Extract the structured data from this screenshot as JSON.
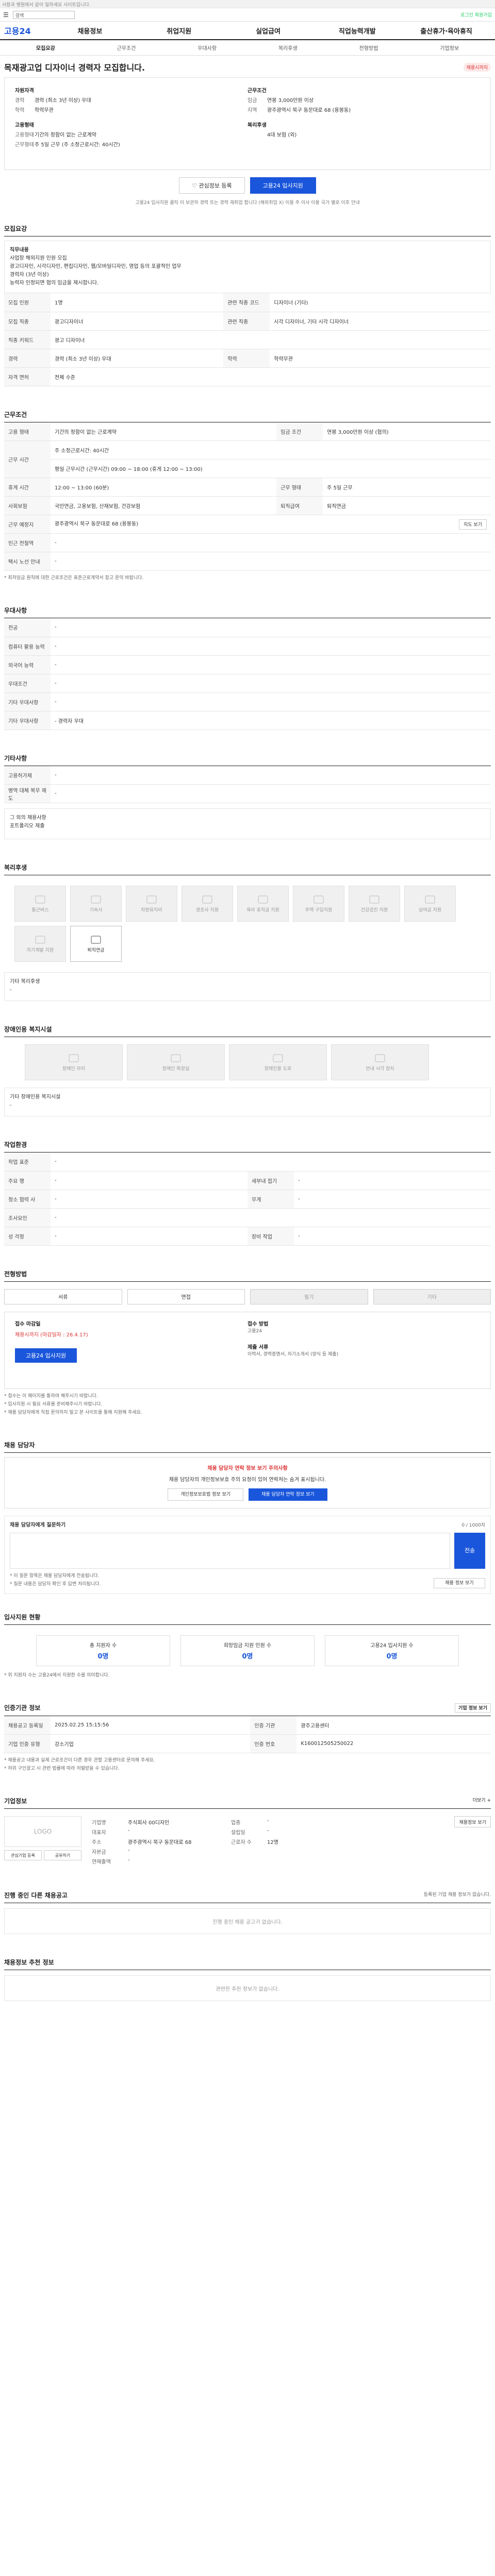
{
  "top": {
    "notice": "사람과 병원에서 같이 일하세요 사이트입니다.",
    "search_placeholder": "검색",
    "right": "로그인 회원가입"
  },
  "nav": {
    "logo": "고용24",
    "items": [
      "채용정보",
      "취업지원",
      "실업급여",
      "직업능력개발",
      "출산휴가·육아휴직"
    ]
  },
  "tabs": [
    "모집요강",
    "근무조건",
    "우대사항",
    "복리후생",
    "전형방법",
    "기업정보"
  ],
  "job": {
    "title": "목재광고업 디자이너 경력자 모집합니다.",
    "badge": "채용시까지"
  },
  "summary": {
    "left_title": "자원자격",
    "left": [
      [
        "경력",
        "경력 (최소 3년 이상) 우대"
      ],
      [
        "학력",
        "학력무관"
      ]
    ],
    "emp_title": "고용형태",
    "emp": [
      [
        "고용형태",
        "기간의 정함이 없는 근로계약"
      ],
      [
        "근무형태",
        "주 5일 근무 (주 소정근로시간: 40시간)"
      ]
    ],
    "right_title": "근무조건",
    "right": [
      [
        "임금",
        "연봉 3,000만원 이상"
      ],
      [
        "지역",
        "광주광역시 북구 동문대로 68 (용봉동)"
      ]
    ],
    "welfare_title": "복리후생",
    "welfare": [
      [
        "",
        "4대 보험 (외)"
      ]
    ]
  },
  "buttons": {
    "save": "관심정보 등록",
    "apply": "고용24 입사지원"
  },
  "note": "고용24 입사지원 클릭 이 보관하 경력 또는 경력 재취업 합니다 (해외취업 X) 이용 주 이사 이용 국가 별로 이후 안내",
  "recruit": {
    "head": "모집요강",
    "desc": [
      "직무내용",
      "사업장 해외지원 인원 모집",
      "광고디자인, 시각디자인, 편집디자인, 웹/모바일디자인, 영업 등의 포괄적인 업무",
      "경력자 (3년 이상)",
      "능력자 인정되면 협의 임금을 제시합니다."
    ],
    "rows": [
      [
        "모집 인원",
        "1명",
        "관련 직종 코드",
        "디자이너 (기타)"
      ],
      [
        "모집 직종",
        "광고디자이너",
        "관련 직종",
        "시각 디자이너, 기타 시각 디자이너"
      ],
      [
        "직종 키워드",
        "광고 디자이너",
        null,
        null
      ],
      [
        "경력",
        "경력 (최소 3년 이상) 우대",
        "학력",
        "학력무관"
      ],
      [
        "자격 면허",
        "전체 수준",
        null,
        null
      ]
    ]
  },
  "work": {
    "head": "근무조건",
    "rows": [
      [
        "고용 형태",
        "기간의 정함이 없는 근로계약",
        "임금 조건",
        "연봉 3,000만원 이상 (협의)"
      ],
      [
        "근무 시간",
        "주 소정근로시간: 40시간",
        "",
        ""
      ],
      [
        "",
        "평일 근무시간 (근무시간) 09:00 ~ 18:00 (휴게 12:00 ~ 13:00)",
        "",
        ""
      ],
      [
        "휴게 시간",
        "12:00 ~ 13:00 (60분)",
        "근무 형태",
        "주 5일 근무"
      ],
      [
        "사회보험",
        "국민연금, 고용보험, 산재보험, 건강보험",
        "퇴직급여",
        "퇴직연금"
      ],
      [
        "근무 예정지",
        "광주광역시 북구 동문대로 68 (용봉동)",
        "",
        ""
      ],
      [
        "인근 전철역",
        "-",
        "",
        ""
      ],
      [
        "택시 노선 안내",
        "-",
        "",
        ""
      ]
    ],
    "map_btn": "지도 보기",
    "note": "* 최저임금 원칙에 대한 근로조건은 표준근로계약서 참고 문의 바랍니다."
  },
  "pref": {
    "head": "우대사항",
    "rows": [
      [
        "전공",
        "-"
      ],
      [
        "컴퓨터 활용 능력",
        "-"
      ],
      [
        "외국어 능력",
        "-"
      ],
      [
        "우대조건",
        "-"
      ],
      [
        "기타 우대사항",
        "-"
      ],
      [
        "기타 우대사항",
        "- 경력자 우대"
      ]
    ]
  },
  "etc": {
    "head": "기타사항",
    "rows": [
      [
        "고용허가제",
        "-"
      ],
      [
        "병역 대체 복무 제도",
        "-"
      ]
    ],
    "box_title": "그 외의 채용사항",
    "box_text": "포트폴리오 제출"
  },
  "welfare": {
    "head": "복리후생",
    "items": [
      [
        "통근버스",
        false
      ],
      [
        "기숙사",
        false
      ],
      [
        "차량유지비",
        false
      ],
      [
        "경조사 지원",
        false
      ],
      [
        "육아 휴직금 지원",
        false
      ],
      [
        "주택 구입지원",
        false
      ],
      [
        "건강검진 지원",
        false
      ],
      [
        "상여금 지원",
        false
      ],
      [
        "자기계발 지원",
        false
      ],
      [
        "퇴직연금",
        true
      ]
    ],
    "other_title": "기타 복리후생",
    "other": "-"
  },
  "disab": {
    "head": "장애인용 복지시설",
    "items": [
      "장애인 자리",
      "장애인 화장실",
      "장애인용 도로",
      "안내 시각 장치"
    ],
    "other_title": "기타 장애인용 복지시설",
    "other": "-"
  },
  "work_env": {
    "head": "작업환경",
    "rows": [
      [
        "작업 표준",
        "-",
        "",
        ""
      ],
      [
        "주요 행",
        "-",
        "세부내 접기",
        "-"
      ],
      [
        "청소 협력 사",
        "-",
        "무게",
        "-"
      ],
      [
        "조사요인",
        "-",
        "",
        ""
      ],
      [
        "성 걱정",
        "-",
        "장비 작업",
        "-"
      ]
    ]
  },
  "select": {
    "head": "전형방법",
    "pills": [
      [
        "서류",
        false
      ],
      [
        "면접",
        false
      ],
      [
        "필기",
        true
      ],
      [
        "기타",
        true
      ]
    ]
  },
  "apply": {
    "left_title": "접수 마감일",
    "deadline": "채용시까지 (마감일자 : 26.4.17)",
    "btn": "고용24 입사지원",
    "right_title": "접수 방법",
    "method": "고용24",
    "doc_title": "제출 서류",
    "docs": "이력서, 경력증명서, 자기소개서 (양식 등 제출)"
  },
  "apply_notes": [
    "* 접수는 이 페이지를 통하여 해주시기 바랍니다.",
    "* 입사지원 시 필요 서류를 준비해주시기 바랍니다.",
    "* 채용 담당자에게 직접 문의하지 말고 본 사이트를 통해 지원해 주세요."
  ],
  "contact": {
    "head": "채용 담당자",
    "title": "채용 담당자 연락 정보 보기 주의사항",
    "text": "채용 담당자의 개인정보보호 주의 요청이 있어 연락처는 숨겨 표시됩니다.",
    "btn1": "개인정보보호법 정보 보기",
    "btn2": "채용 담당자 연락 정보 보기"
  },
  "inquiry": {
    "title": "채용 담당자에게 질문하기",
    "count": "0 / 1000자",
    "btn": "전송",
    "notes": [
      "* 이 질문 항목은 채용 담당자에게 전송됩니다.",
      "* 질문 내용은 담당자 확인 후 답변 처리됩니다."
    ],
    "more": "채용 정보 보기"
  },
  "status": {
    "head": "입사지원 현황",
    "cards": [
      [
        "총 지원자 수",
        "0명"
      ],
      [
        "희망임금 지원 인원 수",
        "0명"
      ],
      [
        "고용24 입사지원 수",
        "0명"
      ]
    ],
    "note": "* 위 지원자 수는 고용24에서 지원한 수를 의미합니다."
  },
  "org": {
    "head": "인증기관 정보",
    "btn": "기업 정보 보기",
    "rows": [
      [
        "채용공고 등록일",
        "2025.02.25 15:15:56",
        "인증 기관",
        "광주고용센터"
      ],
      [
        "기업 인증 유형",
        "강소기업",
        "인증 번호",
        "K160012505250022"
      ]
    ]
  },
  "org_notes": [
    "* 채용공고 내용과 실제 근로조건이 다른 경우 관할 고용센터로 문의해 주세요.",
    "* 허위 구인광고 시 관련 법률에 따라 처벌받을 수 있습니다."
  ],
  "company": {
    "head": "기업정보",
    "more": "더보기 +",
    "logo": "LOGO",
    "share1": "관심기업 등록",
    "share2": "공유하기",
    "rows": [
      [
        "기업명",
        "주식회사 00디자인",
        "업종",
        "-"
      ],
      [
        "대표자",
        "-",
        "설립일",
        "-"
      ],
      [
        "주소",
        "광주광역시 북구 동문대로 68",
        "근로자 수",
        "12명"
      ],
      [
        "자본금",
        "-",
        null,
        null
      ],
      [
        "연매출액",
        "-",
        null,
        null
      ]
    ],
    "map_btn": "채용정보 보기"
  },
  "other_jobs": {
    "head": "진행 중인 다른 채용공고",
    "note": "등록된 기업 채용 정보가 없습니다.",
    "empty": "진행 중인 채용 공고가 없습니다."
  },
  "recommend": {
    "head": "채용정보 추천 정보",
    "empty": "관련한 추천 정보가 없습니다."
  }
}
